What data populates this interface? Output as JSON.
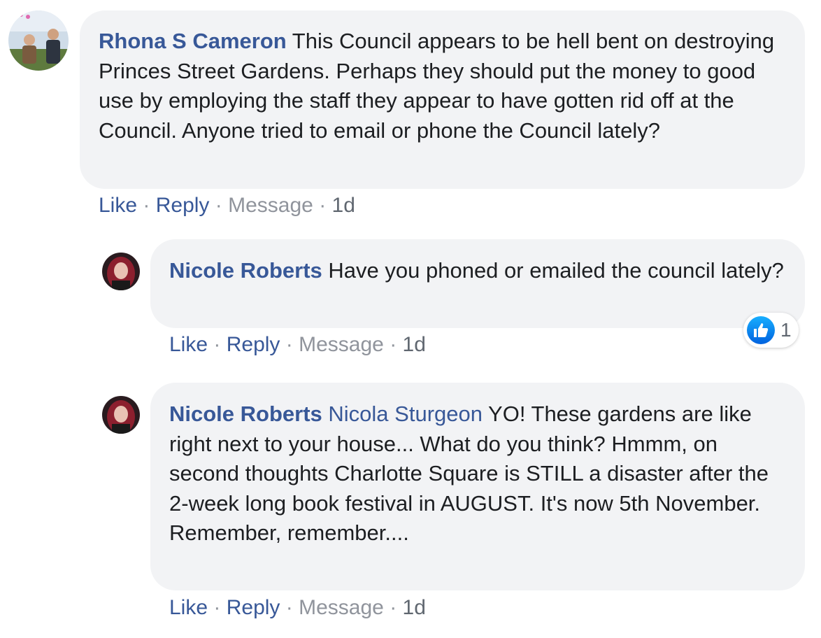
{
  "comments": [
    {
      "author": "Rhona S Cameron",
      "mention": "",
      "text": "This Council appears to be hell bent on destroying Princes Street Gardens. Perhaps they should put the money to good use by employing the staff they appear to have gotten rid off at the Council. Anyone tried to email or phone the Council lately?",
      "actions": {
        "like": "Like",
        "reply": "Reply",
        "message": "Message",
        "time": "1d"
      }
    },
    {
      "author": "Nicole Roberts",
      "mention": "",
      "text": "Have you phoned or emailed the council lately?",
      "reaction": {
        "icon": "thumbs-up-icon",
        "count": "1"
      },
      "actions": {
        "like": "Like",
        "reply": "Reply",
        "message": "Message",
        "time": "1d"
      }
    },
    {
      "author": "Nicole Roberts",
      "mention": "Nicola Sturgeon",
      "text": "YO! These gardens are like right next to your house... What do you think? Hmmm, on second thoughts Charlotte Square is STILL a disaster after the 2-week long book festival in AUGUST. It's now 5th November. Remember, remember....",
      "actions": {
        "like": "Like",
        "reply": "Reply",
        "message": "Message",
        "time": "1d"
      }
    }
  ],
  "separator": "·",
  "colors": {
    "author": "#385898",
    "bubble": "#f2f3f5",
    "muted": "#90949c",
    "like_badge": "#1877f2"
  }
}
